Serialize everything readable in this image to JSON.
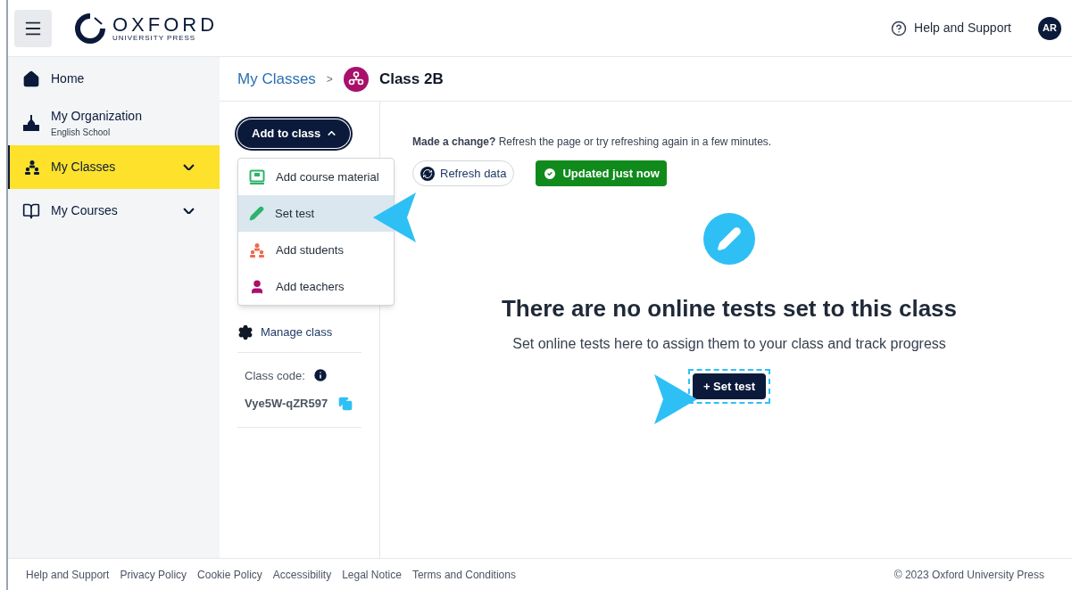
{
  "header": {
    "logo": {
      "name": "OXFORD",
      "subtitle": "UNIVERSITY PRESS"
    },
    "help": "Help and Support",
    "avatar": "AR"
  },
  "sidebar": {
    "items": [
      {
        "kind": "home",
        "label": "Home",
        "selected": false
      },
      {
        "kind": "organization",
        "label": "My Organization",
        "sublabel": "English School",
        "selected": false
      },
      {
        "kind": "classes",
        "label": "My Classes",
        "selected": true,
        "expanded": false
      },
      {
        "kind": "courses",
        "label": "My Courses",
        "selected": false,
        "expanded": false
      }
    ]
  },
  "breadcrumb": {
    "parent": "My Classes",
    "separator": ">",
    "current": "Class 2B"
  },
  "class_panel": {
    "add_button": {
      "label": "Add to class",
      "expanded": true
    },
    "menu": [
      {
        "kind": "course",
        "label": "Add course material",
        "selected": false
      },
      {
        "kind": "test",
        "label": "Set test",
        "selected": true
      },
      {
        "kind": "students",
        "label": "Add students",
        "selected": false
      },
      {
        "kind": "teachers",
        "label": "Add teachers",
        "selected": false
      }
    ],
    "manage": "Manage class",
    "code_label": "Class code:",
    "code": "Vye5W-qZR597"
  },
  "content": {
    "notice_bold": "Made a change?",
    "notice": "Refresh the page or try refreshing again in a few minutes.",
    "refresh": "Refresh data",
    "status": "Updated just now",
    "title": "There are no online tests set to this class",
    "subtitle": "Set online tests here to assign them to your class and track progress",
    "action": "+ Set test"
  },
  "footer": {
    "links": [
      "Help and Support",
      "Privacy Policy",
      "Cookie Policy",
      "Accessibility",
      "Legal Notice",
      "Terms and Conditions"
    ],
    "copyright": "© 2023 Oxford University Press"
  }
}
